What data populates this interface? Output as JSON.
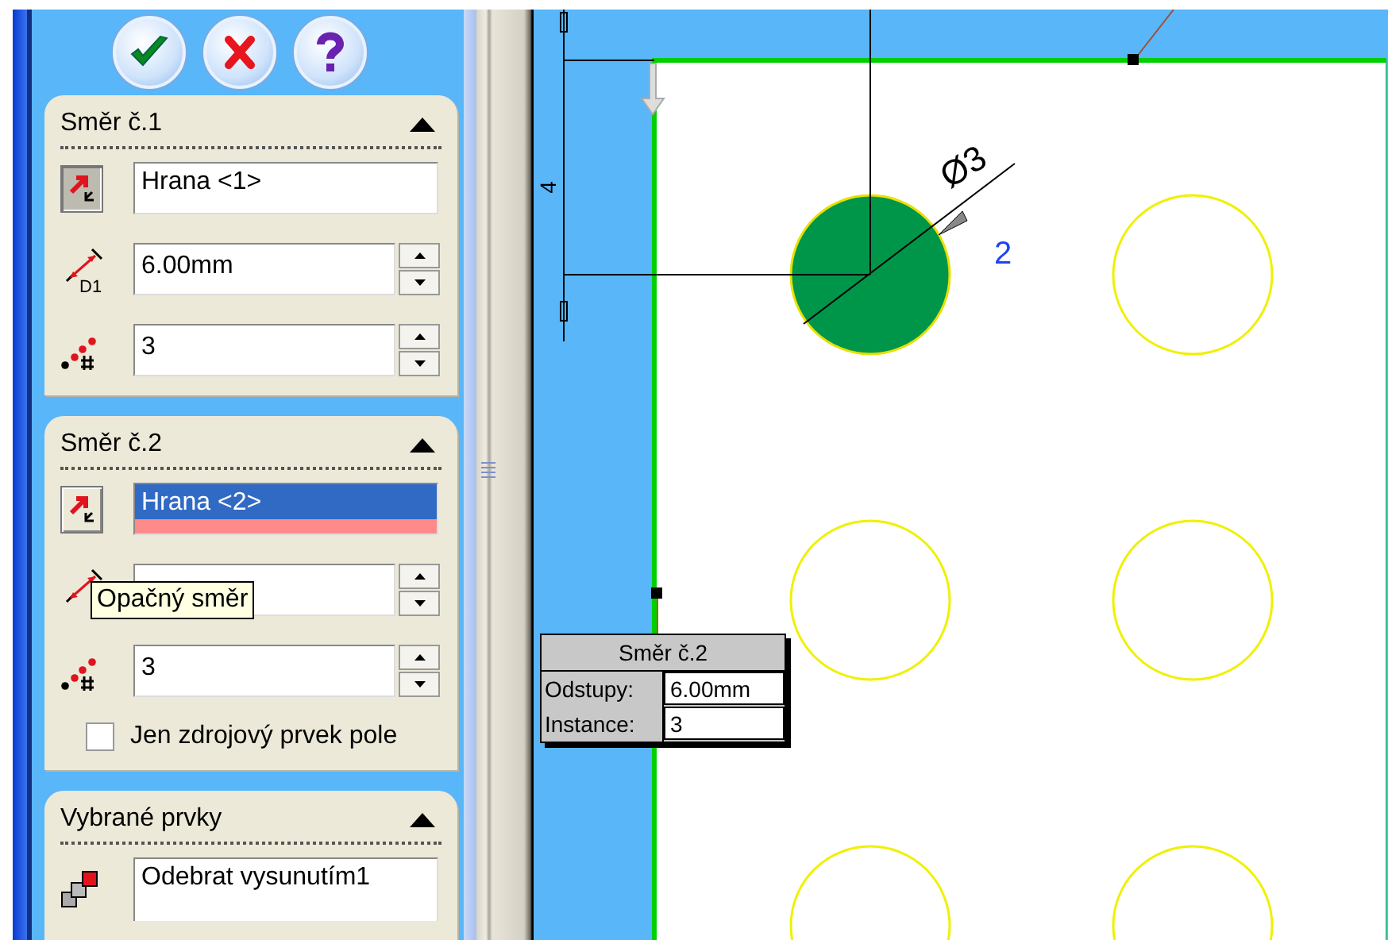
{
  "groups": [
    {
      "kind": "direction",
      "title": "Směr č.1",
      "expanded": true,
      "reverse_pressed": true,
      "edge": {
        "value": "Hrana <1>",
        "selected": false
      },
      "spacing_icon_label": "D1",
      "spacing": "6.00mm",
      "instances": "3"
    },
    {
      "kind": "direction",
      "title": "Směr č.2",
      "expanded": true,
      "reverse_pressed": false,
      "edge": {
        "value": "Hrana <2>",
        "selected": true
      },
      "instances": "3",
      "source_only": {
        "label": "Jen zdrojový prvek pole",
        "checked": false
      }
    },
    {
      "kind": "features",
      "title": "Vybrané prvky",
      "expanded": true,
      "items": [
        "Odebrat vysunutím1"
      ]
    }
  ],
  "tooltip": "Opačný směr",
  "canvas": {
    "dimension": "4",
    "diameter": "Ø3",
    "instance_label": "2",
    "holes": [
      {
        "selected": true
      },
      {
        "selected": false
      },
      {
        "selected": false
      },
      {
        "selected": false
      },
      {
        "selected": false
      },
      {
        "selected": false
      }
    ]
  },
  "popup": {
    "title": "Směr č.2",
    "rows": [
      {
        "label": "Odstupy:",
        "value": "6.00mm"
      },
      {
        "label": "Instance:",
        "value": "3"
      }
    ]
  }
}
